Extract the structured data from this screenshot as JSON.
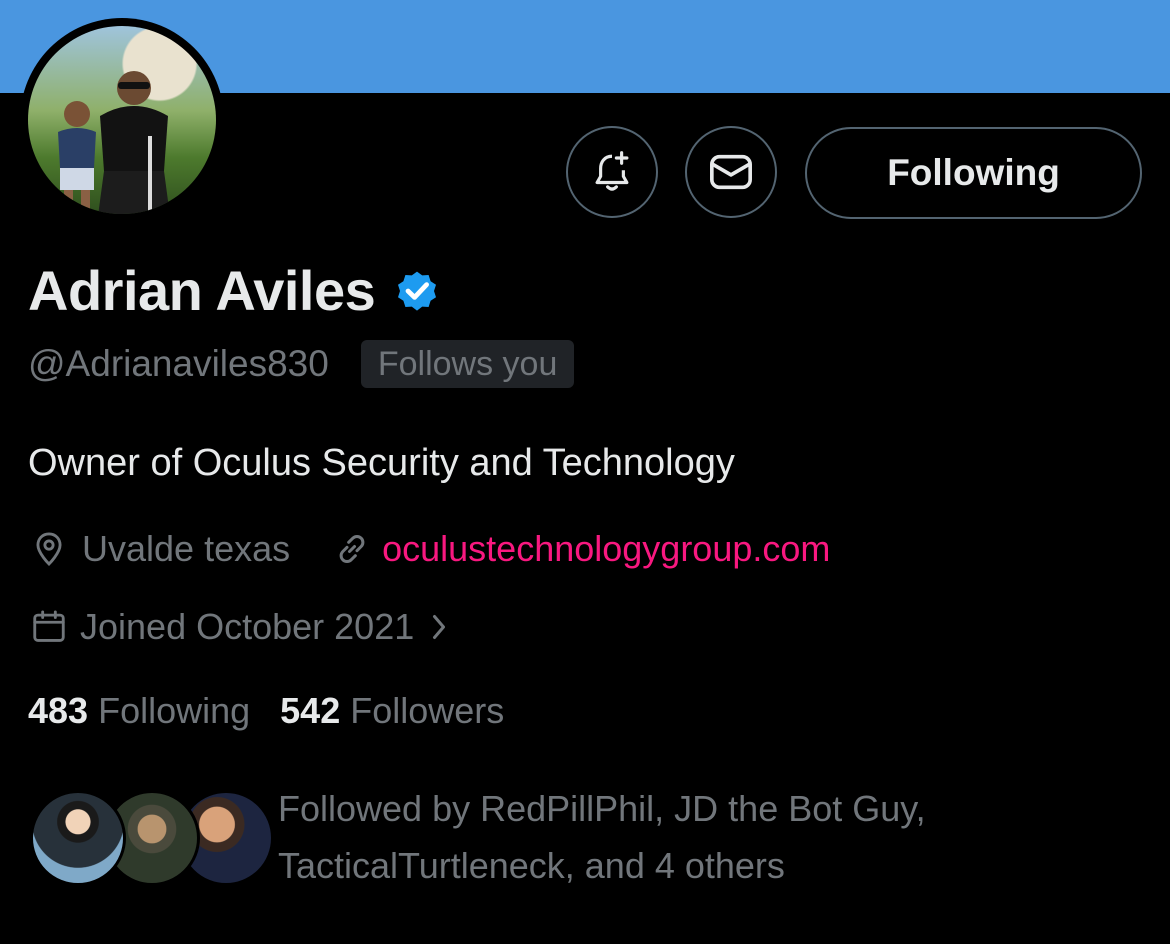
{
  "profile": {
    "name": "Adrian Aviles",
    "handle": "@Adrianaviles830",
    "follows_you_label": "Follows you",
    "bio": "Owner of Oculus Security and Technology",
    "location": "Uvalde texas",
    "website": "oculustechnologygroup.com",
    "joined": "Joined October 2021",
    "following_count": "483",
    "following_label": "Following",
    "followers_count": "542",
    "followers_label": "Followers",
    "followed_by_line1": "Followed by RedPillPhil, JD the Bot Guy,",
    "followed_by_line2": "TacticalTurtleneck, and 4 others"
  },
  "actions": {
    "following_button_label": "Following"
  },
  "icons": {
    "notify": "bell-plus-icon",
    "message": "envelope-icon",
    "verified": "verified-badge-icon",
    "location": "location-pin-icon",
    "link": "link-icon",
    "calendar": "calendar-icon",
    "chevron": "chevron-right-icon"
  },
  "colors": {
    "banner": "#4a96e0",
    "background": "#000000",
    "primary_text": "#e7e9ea",
    "secondary_text": "#71767b",
    "link": "#f91880",
    "verified": "#1d9bf0"
  }
}
